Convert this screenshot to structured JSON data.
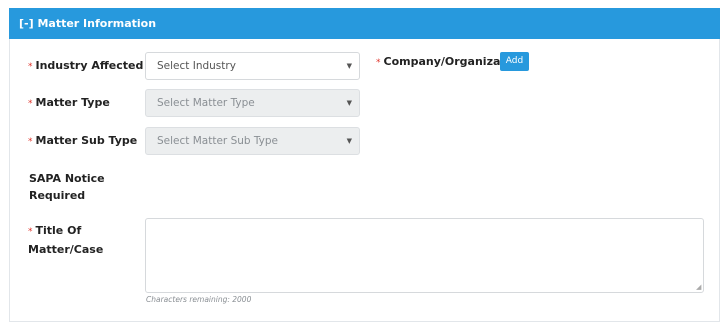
{
  "panel": {
    "title": "[-] Matter Information"
  },
  "required_marker": "*",
  "fields": {
    "industry": {
      "label": "Industry Affected",
      "value": "Select Industry"
    },
    "company": {
      "label": "Company/Organization",
      "add_label": "Add"
    },
    "matter_type": {
      "label": "Matter Type",
      "value": "Select Matter Type"
    },
    "matter_sub_type": {
      "label": "Matter Sub Type",
      "value": "Select Matter Sub Type"
    },
    "sapa": {
      "label_line1": "SAPA Notice",
      "label_line2": "Required"
    },
    "title": {
      "label_line1": "Title Of",
      "label_line2": "Matter/Case",
      "value": ""
    },
    "chars_remaining": "Characters remaining: 2000"
  },
  "caret_glyph": "▼",
  "colors": {
    "header": "#2799dd",
    "required": "#e0342b",
    "button": "#2799dd"
  }
}
